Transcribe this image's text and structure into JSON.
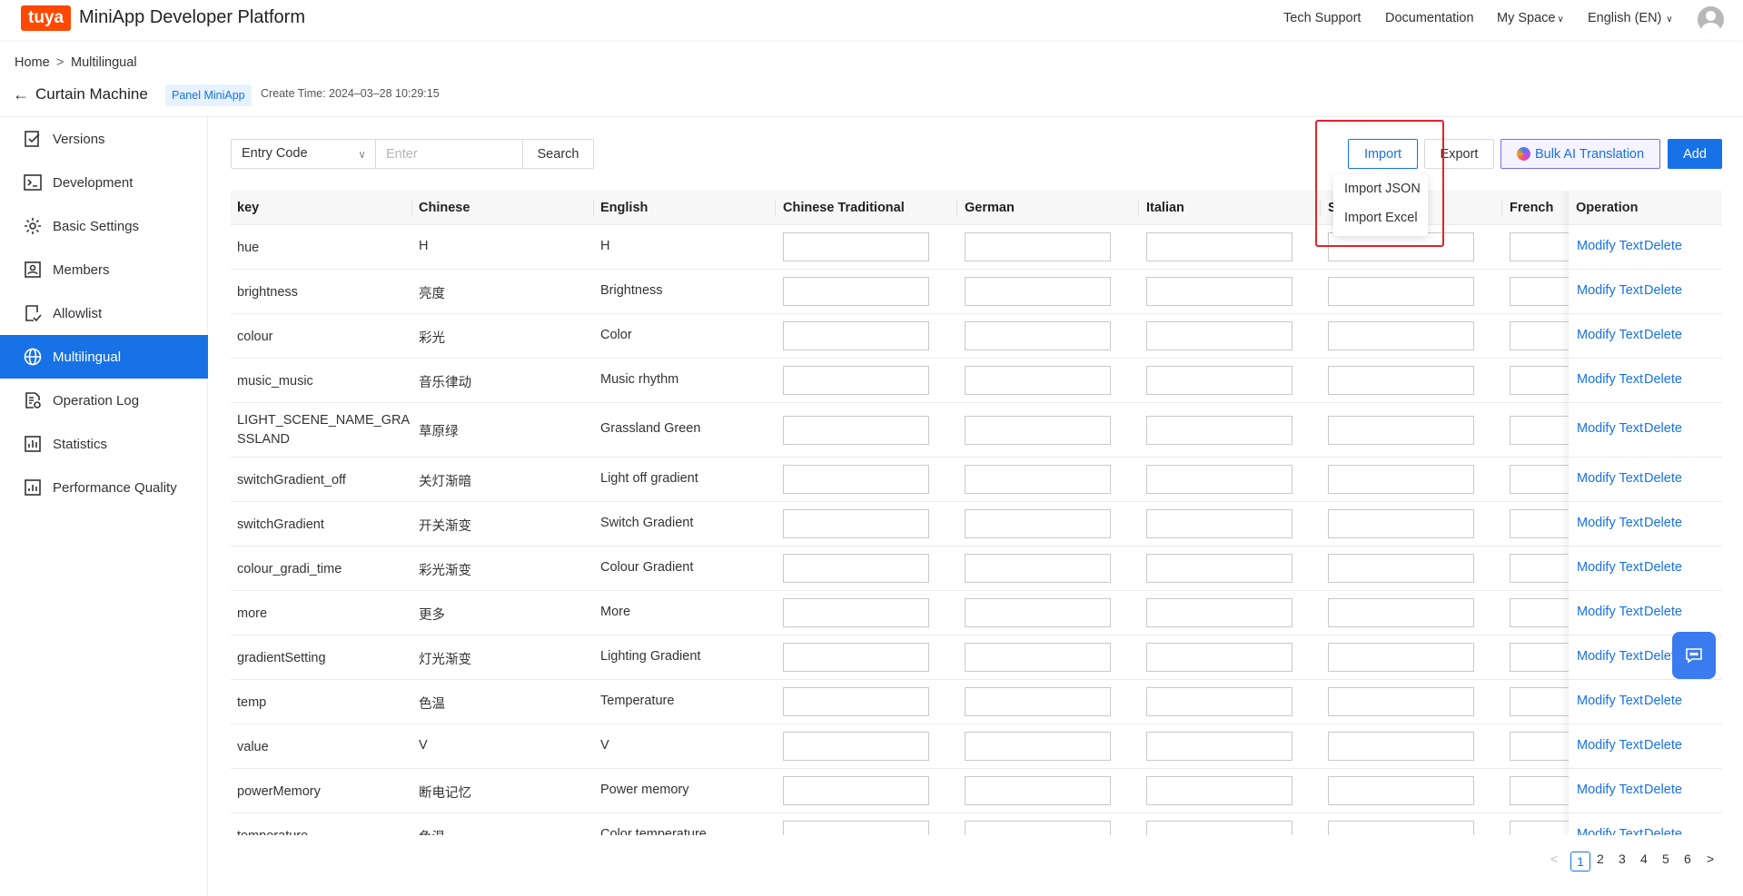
{
  "brand": {
    "logo": "tuya",
    "title": "MiniApp Developer Platform"
  },
  "topnav": {
    "tech_support": "Tech Support",
    "documentation": "Documentation",
    "my_space": "My Space",
    "language": "English (EN)"
  },
  "breadcrumb": {
    "home": "Home",
    "separator": ">",
    "current": "Multilingual"
  },
  "header": {
    "title": "Curtain Machine",
    "tag": "Panel MiniApp",
    "create_time": "Create Time: 2024–03–28 10:29:15"
  },
  "sidebar": {
    "items": [
      {
        "label": "Versions",
        "icon": "versions-icon"
      },
      {
        "label": "Development",
        "icon": "terminal-icon"
      },
      {
        "label": "Basic Settings",
        "icon": "gear-icon"
      },
      {
        "label": "Members",
        "icon": "members-icon"
      },
      {
        "label": "Allowlist",
        "icon": "allowlist-icon"
      },
      {
        "label": "Multilingual",
        "icon": "globe-icon",
        "active": true
      },
      {
        "label": "Operation Log",
        "icon": "log-icon"
      },
      {
        "label": "Statistics",
        "icon": "statistics-icon"
      },
      {
        "label": "Performance Quality",
        "icon": "performance-icon"
      }
    ]
  },
  "toolbar": {
    "filter_select": "Entry Code",
    "search_placeholder": "Enter",
    "search_label": "Search",
    "import_label": "Import",
    "export_label": "Export",
    "ai_label": "Bulk AI Translation",
    "add_label": "Add"
  },
  "import_menu": {
    "json": "Import JSON",
    "excel": "Import Excel"
  },
  "table": {
    "columns": [
      "key",
      "Chinese",
      "English",
      "Chinese Traditional",
      "German",
      "Italian",
      "S",
      "French",
      "Operation"
    ],
    "rows": [
      {
        "key": "hue",
        "zh": "H",
        "en": "H"
      },
      {
        "key": "brightness",
        "zh": "亮度",
        "en": "Brightness"
      },
      {
        "key": "colour",
        "zh": "彩光",
        "en": "Color"
      },
      {
        "key": "music_music",
        "zh": "音乐律动",
        "en": "Music rhythm"
      },
      {
        "key": "LIGHT_SCENE_NAME_GRA",
        "key2": "SSLAND",
        "zh": "草原绿",
        "en": "Grassland Green"
      },
      {
        "key": "switchGradient_off",
        "zh": "关灯渐暗",
        "en": "Light off gradient"
      },
      {
        "key": "switchGradient",
        "zh": "开关渐变",
        "en": "Switch Gradient"
      },
      {
        "key": "colour_gradi_time",
        "zh": "彩光渐变",
        "en": "Colour Gradient"
      },
      {
        "key": "more",
        "zh": "更多",
        "en": "More"
      },
      {
        "key": "gradientSetting",
        "zh": "灯光渐变",
        "en": "Lighting Gradient"
      },
      {
        "key": "temp",
        "zh": "色温",
        "en": "Temperature"
      },
      {
        "key": "value",
        "zh": "V",
        "en": "V"
      },
      {
        "key": "powerMemory",
        "zh": "断电记忆",
        "en": "Power memory"
      },
      {
        "key": "temperature",
        "zh": "色温",
        "en": "Color temperature"
      }
    ],
    "modify_label": "Modify Text",
    "delete_label": "Delete"
  },
  "pagination": {
    "prev": "<",
    "next": ">",
    "pages": [
      "1",
      "2",
      "3",
      "4",
      "5",
      "6"
    ],
    "current": "1"
  },
  "colors": {
    "primary": "#1772e6",
    "brand": "#ff4800",
    "highlight": "#e8202a"
  }
}
